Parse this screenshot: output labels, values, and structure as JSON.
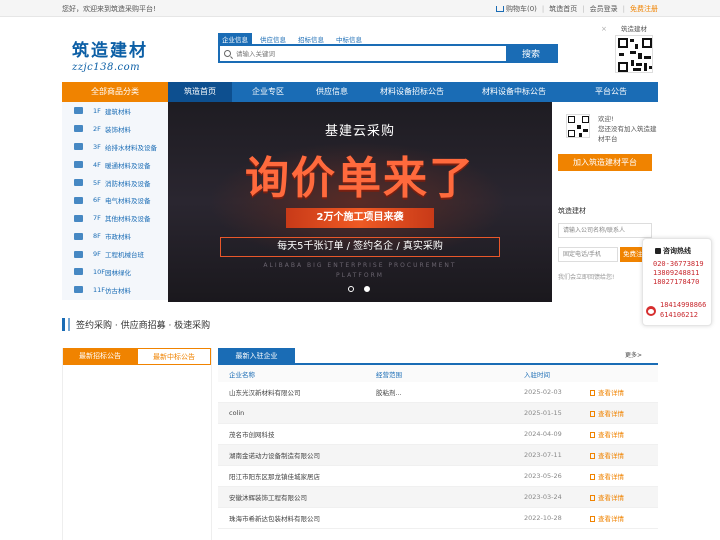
{
  "topbar": {
    "welcome": "您好，欢迎来到筑造采购平台!",
    "cart": "购物车(0)",
    "home": "筑造首页",
    "login": "会员登录",
    "register": "免费注册"
  },
  "logo": {
    "cn": "筑造建材",
    "en": "zzjc138.com"
  },
  "search": {
    "tabs": [
      "企业信息",
      "供应信息",
      "招标信息",
      "中标信息"
    ],
    "placeholder": "请输入关键词",
    "button": "搜索"
  },
  "qr_top_label": "筑造建材",
  "close_symbol": "×",
  "nav": {
    "category": "全部商品分类",
    "items": [
      "筑造首页",
      "企业专区",
      "供应信息",
      "材料设备招标公告",
      "材料设备中标公告",
      "平台公告"
    ]
  },
  "categories": [
    {
      "floor": "1F",
      "name": "建筑材料"
    },
    {
      "floor": "2F",
      "name": "装饰材料"
    },
    {
      "floor": "3F",
      "name": "给排水材料及设备"
    },
    {
      "floor": "4F",
      "name": "暖通材料及设备"
    },
    {
      "floor": "5F",
      "name": "消防材料及设备"
    },
    {
      "floor": "6F",
      "name": "电气材料及设备"
    },
    {
      "floor": "7F",
      "name": "其他材料及设备"
    },
    {
      "floor": "8F",
      "name": "市政材料"
    },
    {
      "floor": "9F",
      "name": "工程机械台班"
    },
    {
      "floor": "10F",
      "name": "园林绿化"
    },
    {
      "floor": "11F",
      "name": "仿古材料"
    }
  ],
  "banner": {
    "line1": "基建云采购",
    "line2": "询价单来了",
    "line3": "2万个施工项目来袭",
    "line4": "每天5千张订单 / 签约名企 / 真实采购",
    "line5": "ALIBABA BIG ENTERPRISE PROCUREMENT",
    "line6": "PLATFORM"
  },
  "rpanel": {
    "hello": "欢迎!\n您还没有加入筑造建材平台",
    "join": "加入筑造建材平台",
    "brand": "筑造建材",
    "company_placeholder": "请输入公司名称/联系人",
    "phone_placeholder": "固定电话/手机",
    "register_btn": "免费注册",
    "tip": "我们会立即回馈给您!"
  },
  "hotline": {
    "title": "咨询热线",
    "numbers": [
      "020-36773819",
      "13809248811",
      "18027178470"
    ],
    "mobile": [
      "18414998866",
      "614106212"
    ]
  },
  "section_title": "签约采购 · 供应商招募 · 极速采购",
  "notice_tabs": [
    "最新招标公告",
    "最新中标公告"
  ],
  "newent": {
    "tab": "最新入驻企业",
    "more": "更多>",
    "columns": [
      "企业名称",
      "经营范围",
      "入驻时间",
      ""
    ],
    "rows": [
      {
        "name": "山东光汉新材料有限公司",
        "scope": "胶粘剂...",
        "date": "2025-02-03",
        "action": "查看详情"
      },
      {
        "name": "colin",
        "scope": "",
        "date": "2025-01-15",
        "action": "查看详情"
      },
      {
        "name": "茂名市创网科技",
        "scope": "",
        "date": "2024-04-09",
        "action": "查看详情"
      },
      {
        "name": "湖南金诺动力设备制造有限公司",
        "scope": "",
        "date": "2023-07-11",
        "action": "查看详情"
      },
      {
        "name": "阳江市阳东区那龙镇佳城家居店",
        "scope": "",
        "date": "2023-05-26",
        "action": "查看详情"
      },
      {
        "name": "安徽沐辉装饰工程有限公司",
        "scope": "",
        "date": "2023-03-24",
        "action": "查看详情"
      },
      {
        "name": "珠海市希新达包装材料有限公司",
        "scope": "",
        "date": "2022-10-28",
        "action": "查看详情"
      }
    ]
  },
  "colors": {
    "brand_blue": "#1a6cb5",
    "brand_orange": "#f08300",
    "banner_red": "#ff6a3d"
  }
}
